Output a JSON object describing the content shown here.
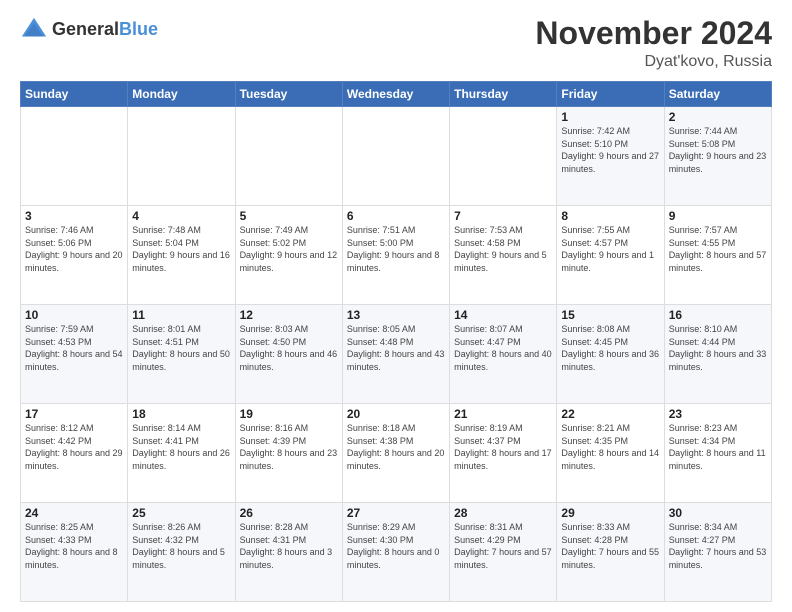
{
  "logo": {
    "general": "General",
    "blue": "Blue"
  },
  "title": "November 2024",
  "location": "Dyat'kovo, Russia",
  "days_of_week": [
    "Sunday",
    "Monday",
    "Tuesday",
    "Wednesday",
    "Thursday",
    "Friday",
    "Saturday"
  ],
  "weeks": [
    [
      {
        "day": "",
        "info": ""
      },
      {
        "day": "",
        "info": ""
      },
      {
        "day": "",
        "info": ""
      },
      {
        "day": "",
        "info": ""
      },
      {
        "day": "",
        "info": ""
      },
      {
        "day": "1",
        "info": "Sunrise: 7:42 AM\nSunset: 5:10 PM\nDaylight: 9 hours and 27 minutes."
      },
      {
        "day": "2",
        "info": "Sunrise: 7:44 AM\nSunset: 5:08 PM\nDaylight: 9 hours and 23 minutes."
      }
    ],
    [
      {
        "day": "3",
        "info": "Sunrise: 7:46 AM\nSunset: 5:06 PM\nDaylight: 9 hours and 20 minutes."
      },
      {
        "day": "4",
        "info": "Sunrise: 7:48 AM\nSunset: 5:04 PM\nDaylight: 9 hours and 16 minutes."
      },
      {
        "day": "5",
        "info": "Sunrise: 7:49 AM\nSunset: 5:02 PM\nDaylight: 9 hours and 12 minutes."
      },
      {
        "day": "6",
        "info": "Sunrise: 7:51 AM\nSunset: 5:00 PM\nDaylight: 9 hours and 8 minutes."
      },
      {
        "day": "7",
        "info": "Sunrise: 7:53 AM\nSunset: 4:58 PM\nDaylight: 9 hours and 5 minutes."
      },
      {
        "day": "8",
        "info": "Sunrise: 7:55 AM\nSunset: 4:57 PM\nDaylight: 9 hours and 1 minute."
      },
      {
        "day": "9",
        "info": "Sunrise: 7:57 AM\nSunset: 4:55 PM\nDaylight: 8 hours and 57 minutes."
      }
    ],
    [
      {
        "day": "10",
        "info": "Sunrise: 7:59 AM\nSunset: 4:53 PM\nDaylight: 8 hours and 54 minutes."
      },
      {
        "day": "11",
        "info": "Sunrise: 8:01 AM\nSunset: 4:51 PM\nDaylight: 8 hours and 50 minutes."
      },
      {
        "day": "12",
        "info": "Sunrise: 8:03 AM\nSunset: 4:50 PM\nDaylight: 8 hours and 46 minutes."
      },
      {
        "day": "13",
        "info": "Sunrise: 8:05 AM\nSunset: 4:48 PM\nDaylight: 8 hours and 43 minutes."
      },
      {
        "day": "14",
        "info": "Sunrise: 8:07 AM\nSunset: 4:47 PM\nDaylight: 8 hours and 40 minutes."
      },
      {
        "day": "15",
        "info": "Sunrise: 8:08 AM\nSunset: 4:45 PM\nDaylight: 8 hours and 36 minutes."
      },
      {
        "day": "16",
        "info": "Sunrise: 8:10 AM\nSunset: 4:44 PM\nDaylight: 8 hours and 33 minutes."
      }
    ],
    [
      {
        "day": "17",
        "info": "Sunrise: 8:12 AM\nSunset: 4:42 PM\nDaylight: 8 hours and 29 minutes."
      },
      {
        "day": "18",
        "info": "Sunrise: 8:14 AM\nSunset: 4:41 PM\nDaylight: 8 hours and 26 minutes."
      },
      {
        "day": "19",
        "info": "Sunrise: 8:16 AM\nSunset: 4:39 PM\nDaylight: 8 hours and 23 minutes."
      },
      {
        "day": "20",
        "info": "Sunrise: 8:18 AM\nSunset: 4:38 PM\nDaylight: 8 hours and 20 minutes."
      },
      {
        "day": "21",
        "info": "Sunrise: 8:19 AM\nSunset: 4:37 PM\nDaylight: 8 hours and 17 minutes."
      },
      {
        "day": "22",
        "info": "Sunrise: 8:21 AM\nSunset: 4:35 PM\nDaylight: 8 hours and 14 minutes."
      },
      {
        "day": "23",
        "info": "Sunrise: 8:23 AM\nSunset: 4:34 PM\nDaylight: 8 hours and 11 minutes."
      }
    ],
    [
      {
        "day": "24",
        "info": "Sunrise: 8:25 AM\nSunset: 4:33 PM\nDaylight: 8 hours and 8 minutes."
      },
      {
        "day": "25",
        "info": "Sunrise: 8:26 AM\nSunset: 4:32 PM\nDaylight: 8 hours and 5 minutes."
      },
      {
        "day": "26",
        "info": "Sunrise: 8:28 AM\nSunset: 4:31 PM\nDaylight: 8 hours and 3 minutes."
      },
      {
        "day": "27",
        "info": "Sunrise: 8:29 AM\nSunset: 4:30 PM\nDaylight: 8 hours and 0 minutes."
      },
      {
        "day": "28",
        "info": "Sunrise: 8:31 AM\nSunset: 4:29 PM\nDaylight: 7 hours and 57 minutes."
      },
      {
        "day": "29",
        "info": "Sunrise: 8:33 AM\nSunset: 4:28 PM\nDaylight: 7 hours and 55 minutes."
      },
      {
        "day": "30",
        "info": "Sunrise: 8:34 AM\nSunset: 4:27 PM\nDaylight: 7 hours and 53 minutes."
      }
    ]
  ]
}
